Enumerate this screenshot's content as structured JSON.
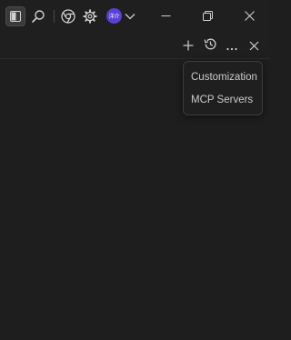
{
  "titlebar": {
    "avatar_text": "洋介",
    "icons": {
      "panel_toggle": "panel-toggle-icon",
      "search": "search-icon",
      "browser": "chrome-icon",
      "settings": "gear-icon",
      "account_dropdown": "chevron-down-icon",
      "minimize": "minimize-icon",
      "restore": "restore-icon",
      "close": "close-icon"
    }
  },
  "panel_toolbar": {
    "icons": {
      "new": "plus-icon",
      "history": "history-icon",
      "more": "ellipsis-icon",
      "close": "close-icon"
    }
  },
  "menu": {
    "items": [
      {
        "label": "Customization"
      },
      {
        "label": "MCP Servers"
      }
    ]
  },
  "colors": {
    "background": "#1e1e1e",
    "avatar": "#5b3fd6",
    "text": "#cccccc",
    "border": "#3c3c3c"
  }
}
